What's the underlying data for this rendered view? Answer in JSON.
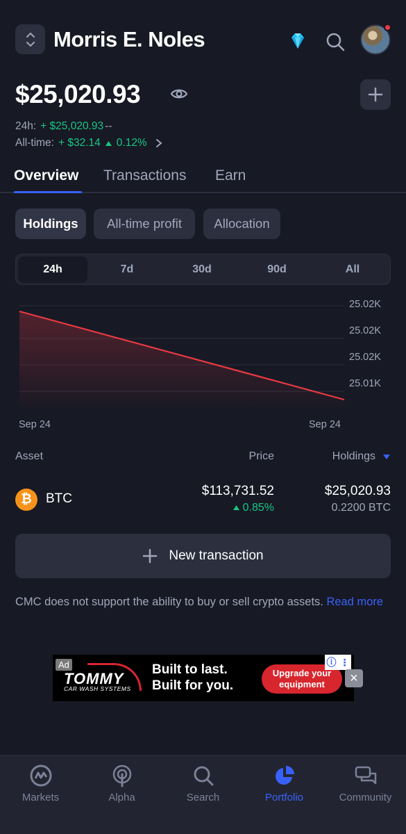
{
  "header": {
    "portfolio_name": "Morris E. Noles",
    "icons": [
      "sort-arrows-icon",
      "diamond-icon",
      "search-icon",
      "avatar"
    ]
  },
  "balance": {
    "total": "$25,020.93",
    "change_24h_label": "24h:",
    "change_24h_value": "+ $25,020.93",
    "change_24h_pct": "--",
    "alltime_label": "All-time:",
    "alltime_value": "+ $32.14",
    "alltime_pct": "0.12%"
  },
  "tabs": [
    {
      "label": "Overview",
      "active": true
    },
    {
      "label": "Transactions",
      "active": false
    },
    {
      "label": "Earn",
      "active": false
    }
  ],
  "chips": [
    {
      "label": "Holdings",
      "active": true
    },
    {
      "label": "All-time profit",
      "active": false
    },
    {
      "label": "Allocation",
      "active": false
    }
  ],
  "timeframes": [
    {
      "label": "24h",
      "active": true
    },
    {
      "label": "7d",
      "active": false
    },
    {
      "label": "30d",
      "active": false
    },
    {
      "label": "90d",
      "active": false
    },
    {
      "label": "All",
      "active": false
    }
  ],
  "chart_data": {
    "type": "area",
    "y_ticks": [
      "25.02K",
      "25.02K",
      "25.02K",
      "25.01K"
    ],
    "x_ticks": [
      "Sep 24",
      "Sep 24"
    ],
    "series": [
      {
        "values": [
          1.0,
          0.0
        ]
      }
    ],
    "line_color": "#ea3943",
    "grid": true
  },
  "table": {
    "headers": {
      "asset": "Asset",
      "price": "Price",
      "holdings": "Holdings"
    },
    "rows": [
      {
        "symbol": "BTC",
        "price": "$113,731.52",
        "change": "0.85%",
        "value": "$25,020.93",
        "amount": "0.2200 BTC"
      }
    ]
  },
  "new_transaction": "New transaction",
  "disclaimer": {
    "text": "CMC does not support the ability to buy or sell crypto assets. ",
    "link": "Read more"
  },
  "ad": {
    "badge": "Ad",
    "brand": "TOMMY",
    "brand_sub": "CAR WASH SYSTEMS",
    "headline_1": "Built to last.",
    "headline_2": "Built for you.",
    "cta": "Upgrade your equipment"
  },
  "bottom_nav": [
    {
      "label": "Markets",
      "active": false
    },
    {
      "label": "Alpha",
      "active": false
    },
    {
      "label": "Search",
      "active": false
    },
    {
      "label": "Portfolio",
      "active": true
    },
    {
      "label": "Community",
      "active": false
    }
  ]
}
